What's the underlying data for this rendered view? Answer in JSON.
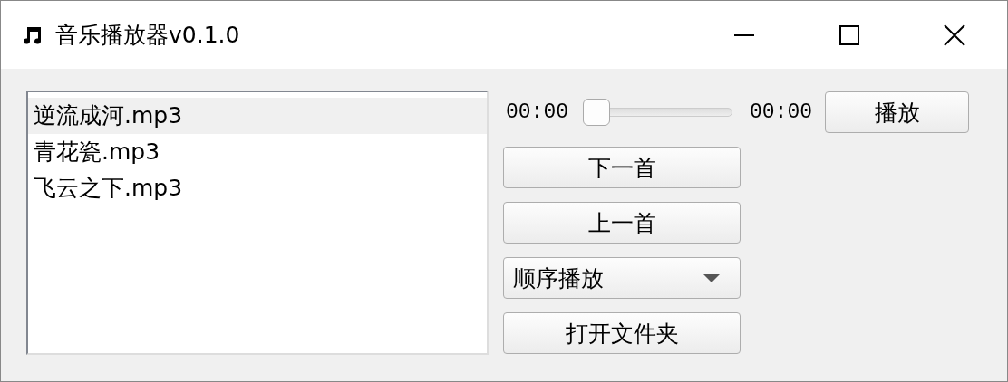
{
  "window": {
    "title": "音乐播放器v0.1.0"
  },
  "playlist": {
    "items": [
      {
        "label": "逆流成河.mp3",
        "selected": true
      },
      {
        "label": "青花瓷.mp3",
        "selected": false
      },
      {
        "label": "飞云之下.mp3",
        "selected": false
      }
    ]
  },
  "progress": {
    "elapsed": "00:00",
    "level": 0,
    "total": "00:00"
  },
  "play_button": "播放",
  "controls": [
    {
      "kind": "button",
      "label": "下一首"
    },
    {
      "kind": "button",
      "label": "上一首"
    },
    {
      "kind": "dropdown",
      "label": "顺序播放"
    },
    {
      "kind": "button",
      "label": "打开文件夹"
    }
  ]
}
